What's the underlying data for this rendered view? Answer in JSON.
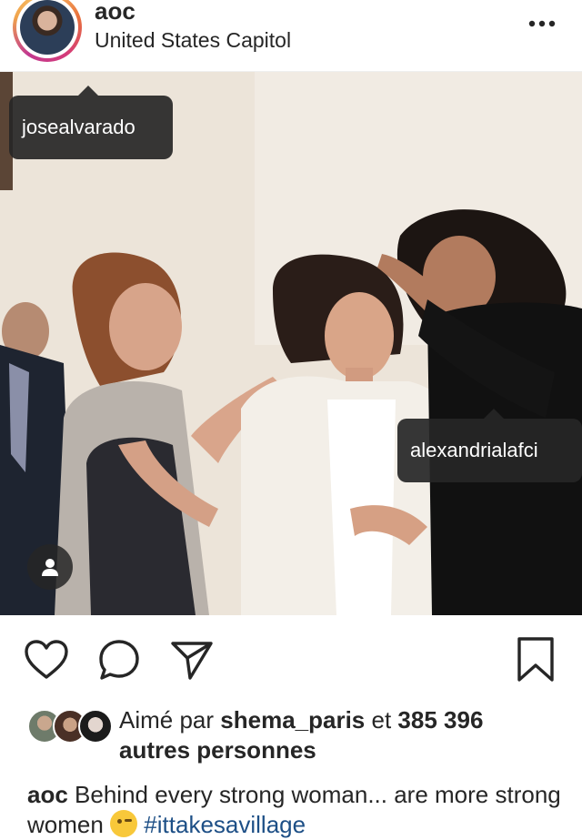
{
  "post": {
    "username": "aoc",
    "location": "United States Capitol"
  },
  "icons": {
    "more": "more-options-icon",
    "like": "heart-icon",
    "comment": "comment-bubble-icon",
    "share": "paper-plane-icon",
    "save": "bookmark-icon",
    "tagged_users": "person-icon"
  },
  "tags": [
    {
      "name": "josealvarado"
    },
    {
      "name": "alexandrialafci"
    }
  ],
  "likes": {
    "prefix": "Aimé par",
    "user": "shema_paris",
    "connector": "et",
    "count": "385 396",
    "suffix": "autres personnes"
  },
  "caption": {
    "username": "aoc",
    "text": "Behind every strong woman... are more strong women",
    "hashtag": "#ittakesavillage"
  },
  "colors": {
    "text": "#262626",
    "hashtag": "#1d4f86",
    "tag_background": "#262626"
  }
}
